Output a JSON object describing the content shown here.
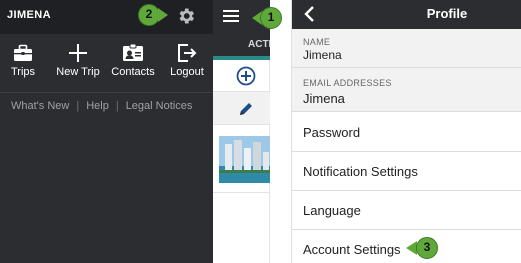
{
  "drawer": {
    "user_name": "JIMENA",
    "actions": [
      {
        "label": "Trips",
        "icon": "briefcase-icon"
      },
      {
        "label": "New Trip",
        "icon": "plus-icon"
      },
      {
        "label": "Contacts",
        "icon": "contact-card-icon"
      },
      {
        "label": "Logout",
        "icon": "logout-icon"
      }
    ],
    "links": [
      "What's New",
      "Help",
      "Legal Notices"
    ],
    "separator": "|"
  },
  "middle": {
    "tab_label": "ACTIVE",
    "accent_color": "#2a8a87"
  },
  "profile": {
    "title": "Profile",
    "name_label": "NAME",
    "name_value": "Jimena",
    "email_label": "EMAIL ADDRESSES",
    "email_value": "Jimena",
    "menu": [
      "Password",
      "Notification Settings",
      "Language",
      "Account Settings"
    ]
  },
  "callouts": [
    "1",
    "2",
    "3"
  ],
  "colors": {
    "dark_header": "#2b2d30",
    "callout_green": "#5fa83a"
  }
}
